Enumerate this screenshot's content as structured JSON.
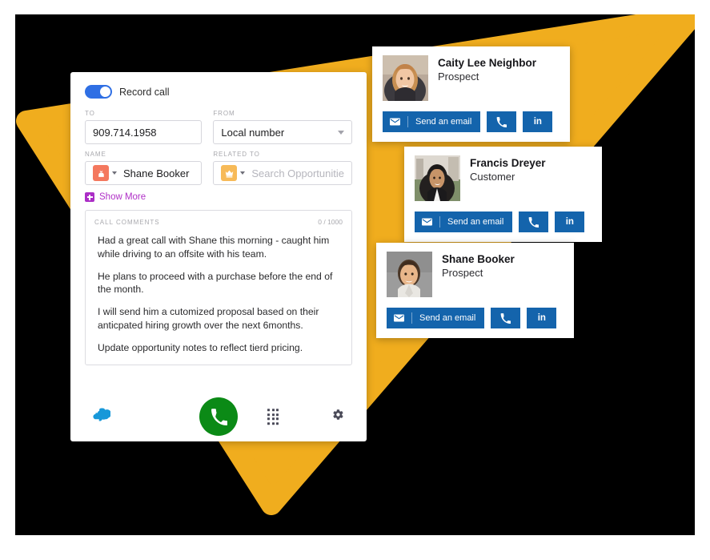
{
  "theme": {
    "wedge_color": "#f0ad1e",
    "backdrop_color": "#000000",
    "toggle_on_color": "#2f6fe4",
    "call_button_color": "#0b8a16",
    "card_button_color": "#1464ac",
    "show_more_color": "#b030c7",
    "lead_icon_color": "#f4785e",
    "opportunity_icon_color": "#f7ba58"
  },
  "dialer": {
    "record_toggle": {
      "label": "Record call",
      "state": "on"
    },
    "fields": {
      "to": {
        "label": "TO",
        "value": "909.714.1958"
      },
      "from": {
        "label": "FROM",
        "value": "Local number",
        "options": [
          "Local number"
        ]
      },
      "name": {
        "label": "NAME",
        "value": "Shane Booker",
        "record_icon": "lead-icon"
      },
      "related_to": {
        "label": "RELATED TO",
        "value": "",
        "placeholder": "Search Opportunitie",
        "record_icon": "opportunity-icon"
      }
    },
    "show_more": {
      "label": "Show More",
      "icon": "plus-square-icon"
    },
    "comments": {
      "title": "CALL COMMENTS",
      "counter": "0 / 1000",
      "paragraphs": [
        "Had a great call with Shane this morning - caught him while driving to an offsite with his team.",
        "He plans to proceed with a purchase before the end of the month.",
        "I will send him a cutomized proposal based on their anticpated hiring growth over the next 6months.",
        "Update opportunity notes to reflect tierd pricing."
      ]
    },
    "actions": {
      "cloud_icon": "salesforce-cloud-icon",
      "call_icon": "phone-icon",
      "dialpad_icon": "dialpad-icon",
      "settings_icon": "gear-icon"
    }
  },
  "contact_cards": [
    {
      "name": "Caity Lee Neighbor",
      "role": "Prospect",
      "avatar": "photo-caity-lee-neighbor",
      "buttons": {
        "email_label": "Send an email",
        "email_icon": "envelope-icon",
        "call_icon": "phone-icon",
        "linkedin_label": "in"
      }
    },
    {
      "name": "Francis Dreyer",
      "role": "Customer",
      "avatar": "photo-francis-dreyer",
      "buttons": {
        "email_label": "Send an email",
        "email_icon": "envelope-icon",
        "call_icon": "phone-icon",
        "linkedin_label": "in"
      }
    },
    {
      "name": "Shane Booker",
      "role": "Prospect",
      "avatar": "photo-shane-booker",
      "buttons": {
        "email_label": "Send an email",
        "email_icon": "envelope-icon",
        "call_icon": "phone-icon",
        "linkedin_label": "in"
      }
    }
  ]
}
